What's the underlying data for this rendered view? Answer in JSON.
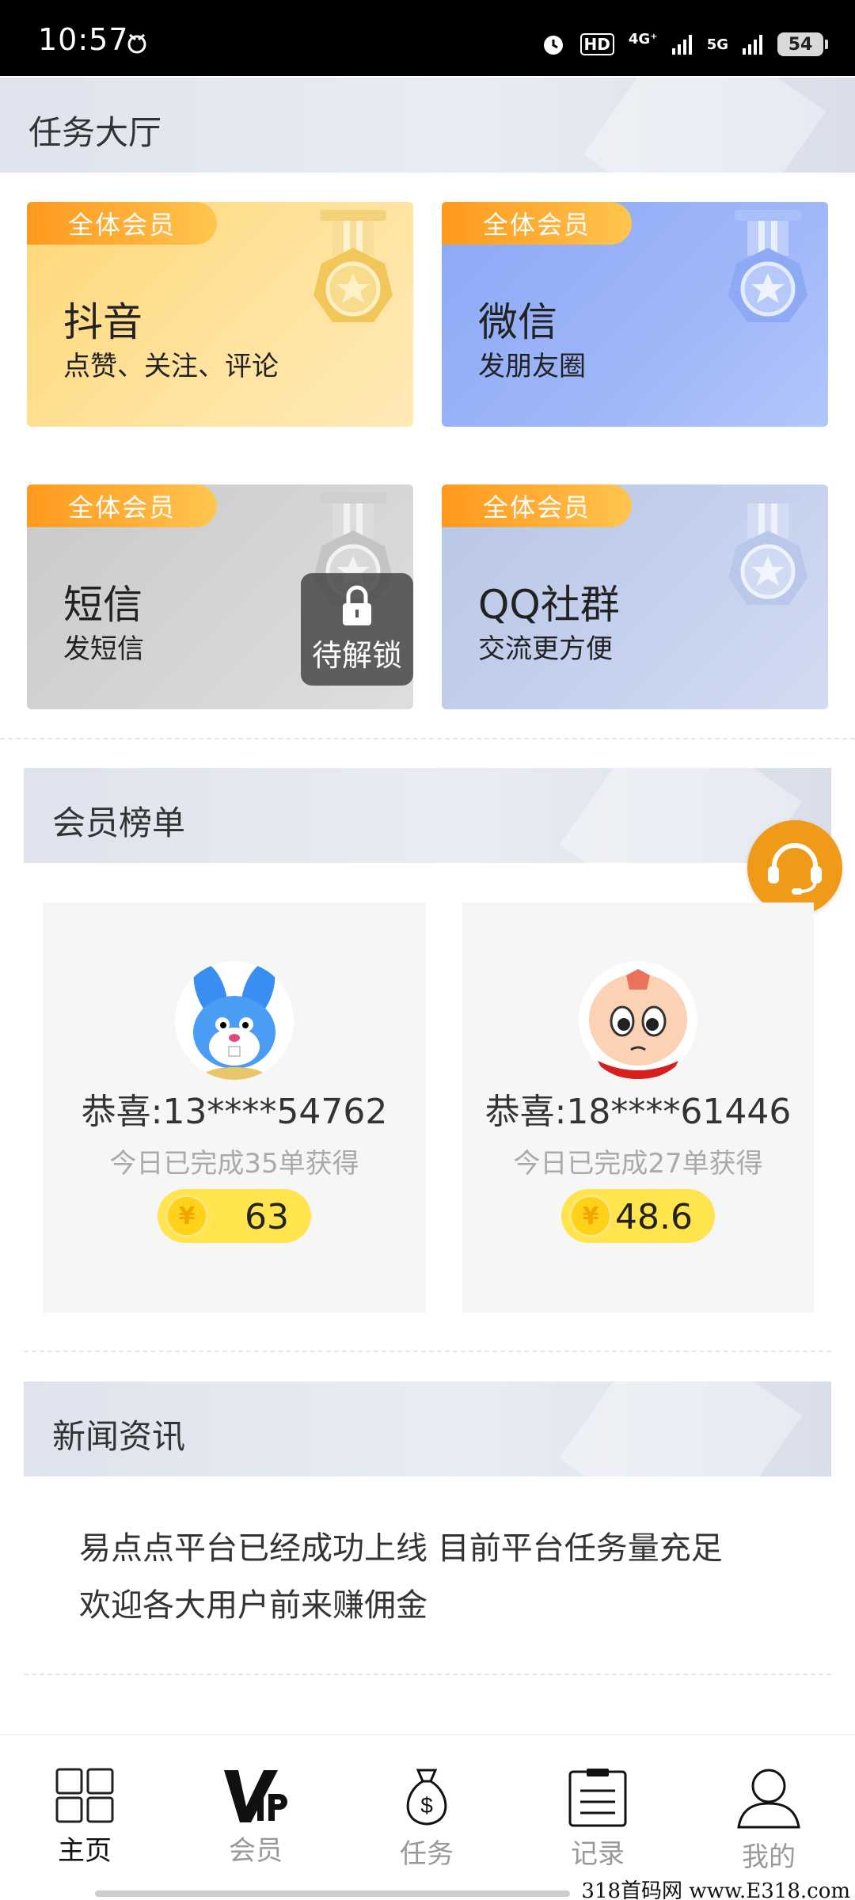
{
  "status_bar": {
    "time": "10:57",
    "battery": "54",
    "network_labels": [
      "HD",
      "4G⁺",
      "5G"
    ]
  },
  "task_hall": {
    "title": "任务大厅",
    "cards": [
      {
        "badge": "全体会员",
        "title": "抖音",
        "subtitle": "点赞、关注、评论",
        "locked": false
      },
      {
        "badge": "全体会员",
        "title": "微信",
        "subtitle": "发朋友圈",
        "locked": false
      },
      {
        "badge": "全体会员",
        "title": "短信",
        "subtitle": "发短信",
        "locked": true,
        "lock_label": "待解锁"
      },
      {
        "badge": "全体会员",
        "title": "QQ社群",
        "subtitle": "交流更方便",
        "locked": false
      }
    ]
  },
  "ranking": {
    "title": "会员榜单",
    "entries": [
      {
        "name": "恭喜:13****54762",
        "desc": "今日已完成35单获得",
        "reward": "63",
        "avatar": "blue-rabbit-avatar"
      },
      {
        "name": "恭喜:18****61446",
        "desc": "今日已完成27单获得",
        "reward": "48.6",
        "avatar": "cartoon-boy-avatar"
      }
    ],
    "coin_symbol": "¥"
  },
  "news": {
    "title": "新闻资讯",
    "lines": [
      "易点点平台已经成功上线 目前平台任务量充足",
      "欢迎各大用户前来赚佣金"
    ]
  },
  "bottom_nav": [
    {
      "label": "主页",
      "icon": "grid-icon",
      "active": true
    },
    {
      "label": "会员",
      "icon": "vip-icon",
      "active": false
    },
    {
      "label": "任务",
      "icon": "money-bag-icon",
      "active": false
    },
    {
      "label": "记录",
      "icon": "clipboard-icon",
      "active": false
    },
    {
      "label": "我的",
      "icon": "user-icon",
      "active": false
    }
  ],
  "watermark": "318首码网 www.E318.com",
  "colors": {
    "accent_orange": "#f09a1a",
    "badge_orange": "#ffa62a",
    "reward_yellow": "#ffe44d"
  }
}
